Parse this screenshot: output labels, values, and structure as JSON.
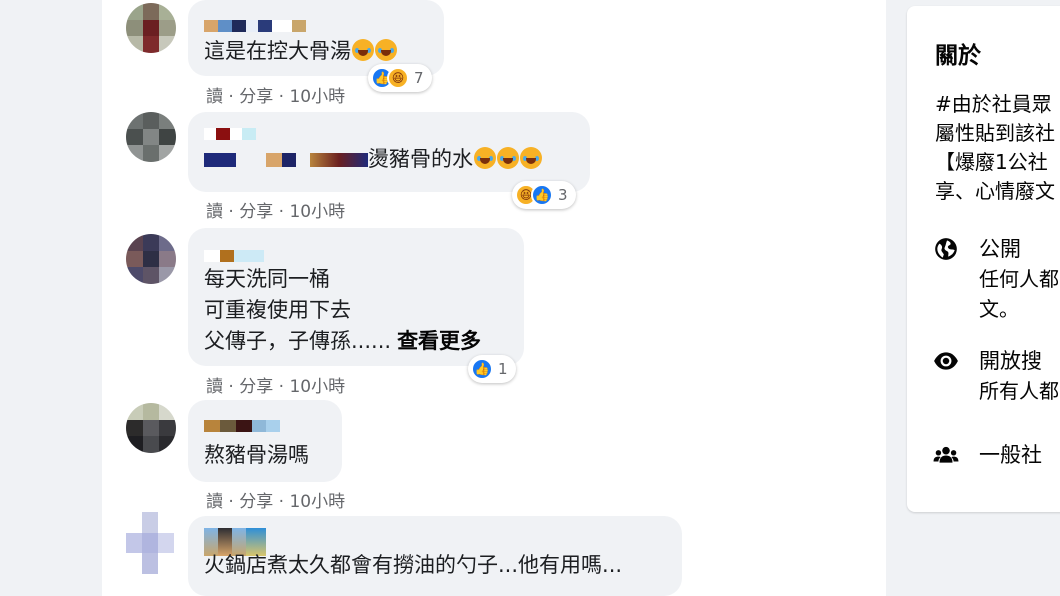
{
  "comments": [
    {
      "text": "這是在控大骨湯",
      "emoji_count": 2,
      "actions": {
        "read": "讀",
        "share": "分享",
        "time": "10小時"
      },
      "reactions": {
        "icons": [
          "like-icon",
          "haha-icon"
        ],
        "count": "7"
      }
    },
    {
      "text": "燙豬骨的水",
      "emoji_count": 3,
      "actions": {
        "read": "讀",
        "share": "分享",
        "time": "10小時"
      },
      "reactions": {
        "icons": [
          "haha-icon",
          "like-icon"
        ],
        "count": "3"
      }
    },
    {
      "text": "每天洗同一桶\n可重複使用下去\n父傳子，子傳孫......",
      "see_more": "查看更多",
      "actions": {
        "read": "讀",
        "share": "分享",
        "time": "10小時"
      },
      "reactions": {
        "icons": [
          "like-icon"
        ],
        "count": "1"
      }
    },
    {
      "text": "熬豬骨湯嗎",
      "actions": {
        "read": "讀",
        "share": "分享",
        "time": "10小時"
      }
    },
    {
      "text": "火鍋店煮太久都會有撈油的勺子...他有用嗎..."
    }
  ],
  "separator": "·",
  "about": {
    "title": "關於",
    "description": "#由於社員眾\n屬性貼到該社\n【爆廢1公社\n享、心情廢文",
    "items": [
      {
        "icon": "globe-icon",
        "title": "公開",
        "subtitle": "任何人都\n文。"
      },
      {
        "icon": "eye-icon",
        "title": "開放搜",
        "subtitle": "所有人都"
      },
      {
        "icon": "group-icon",
        "title": "一般社",
        "subtitle": ""
      }
    ]
  },
  "colors": {
    "like": "#1877f2",
    "haha": "#f7b125",
    "bubble": "#f0f2f5",
    "meta": "#65676b"
  }
}
